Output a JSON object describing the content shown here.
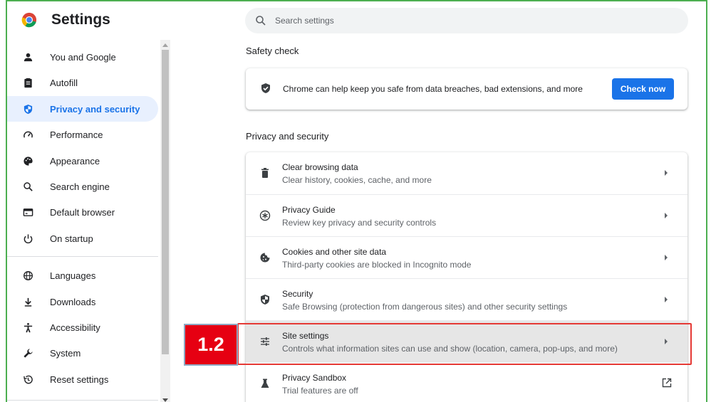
{
  "header": {
    "title": "Settings",
    "search_placeholder": "Search settings"
  },
  "sidebar": {
    "items": [
      {
        "label": "You and Google",
        "icon": "person-icon"
      },
      {
        "label": "Autofill",
        "icon": "clipboard-icon"
      },
      {
        "label": "Privacy and security",
        "icon": "shield-icon",
        "active": true
      },
      {
        "label": "Performance",
        "icon": "speedometer-icon"
      },
      {
        "label": "Appearance",
        "icon": "palette-icon"
      },
      {
        "label": "Search engine",
        "icon": "search-icon"
      },
      {
        "label": "Default browser",
        "icon": "browser-icon"
      },
      {
        "label": "On startup",
        "icon": "power-icon"
      },
      {
        "label": "Languages",
        "icon": "globe-icon"
      },
      {
        "label": "Downloads",
        "icon": "download-icon"
      },
      {
        "label": "Accessibility",
        "icon": "accessibility-icon"
      },
      {
        "label": "System",
        "icon": "wrench-icon"
      },
      {
        "label": "Reset settings",
        "icon": "history-icon"
      }
    ]
  },
  "main": {
    "safety_check": {
      "heading": "Safety check",
      "text": "Chrome can help keep you safe from data breaches, bad extensions, and more",
      "button": "Check now"
    },
    "privacy": {
      "heading": "Privacy and security",
      "rows": [
        {
          "title": "Clear browsing data",
          "subtitle": "Clear history, cookies, cache, and more",
          "icon": "trash-icon"
        },
        {
          "title": "Privacy Guide",
          "subtitle": "Review key privacy and security controls",
          "icon": "privacy-guide-icon"
        },
        {
          "title": "Cookies and other site data",
          "subtitle": "Third-party cookies are blocked in Incognito mode",
          "icon": "cookie-icon"
        },
        {
          "title": "Security",
          "subtitle": "Safe Browsing (protection from dangerous sites) and other security settings",
          "icon": "security-shield-icon"
        },
        {
          "title": "Site settings",
          "subtitle": "Controls what information sites can use and show (location, camera, pop-ups, and more)",
          "icon": "sliders-icon"
        },
        {
          "title": "Privacy Sandbox",
          "subtitle": "Trial features are off",
          "icon": "flask-icon"
        }
      ]
    }
  },
  "annotation": {
    "step_label": "1.2"
  },
  "colors": {
    "accent": "#1a73e8",
    "active_bg": "#e8f0fe",
    "highlight_border": "#e53935",
    "badge_bg": "#e60012",
    "frame_border": "#4caf50"
  }
}
